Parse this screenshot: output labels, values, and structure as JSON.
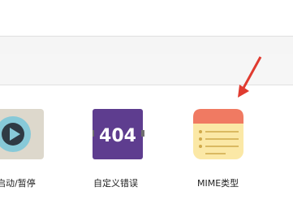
{
  "icons": [
    {
      "name": "start-stop",
      "label": "启动/暂停",
      "icon": "play-icon"
    },
    {
      "name": "custom-error",
      "label": "自定义错误",
      "icon": "error-404-icon",
      "badge_text": "404"
    },
    {
      "name": "mime-type",
      "label": "MIME类型",
      "icon": "notepad-icon"
    }
  ],
  "colors": {
    "play_bg": "#ddd8cc",
    "play_circle": "#87c9d8",
    "error_bg": "#5e3d8f",
    "mime_header": "#f07a62",
    "mime_body": "#fbe8a6",
    "arrow": "#e03b30"
  }
}
